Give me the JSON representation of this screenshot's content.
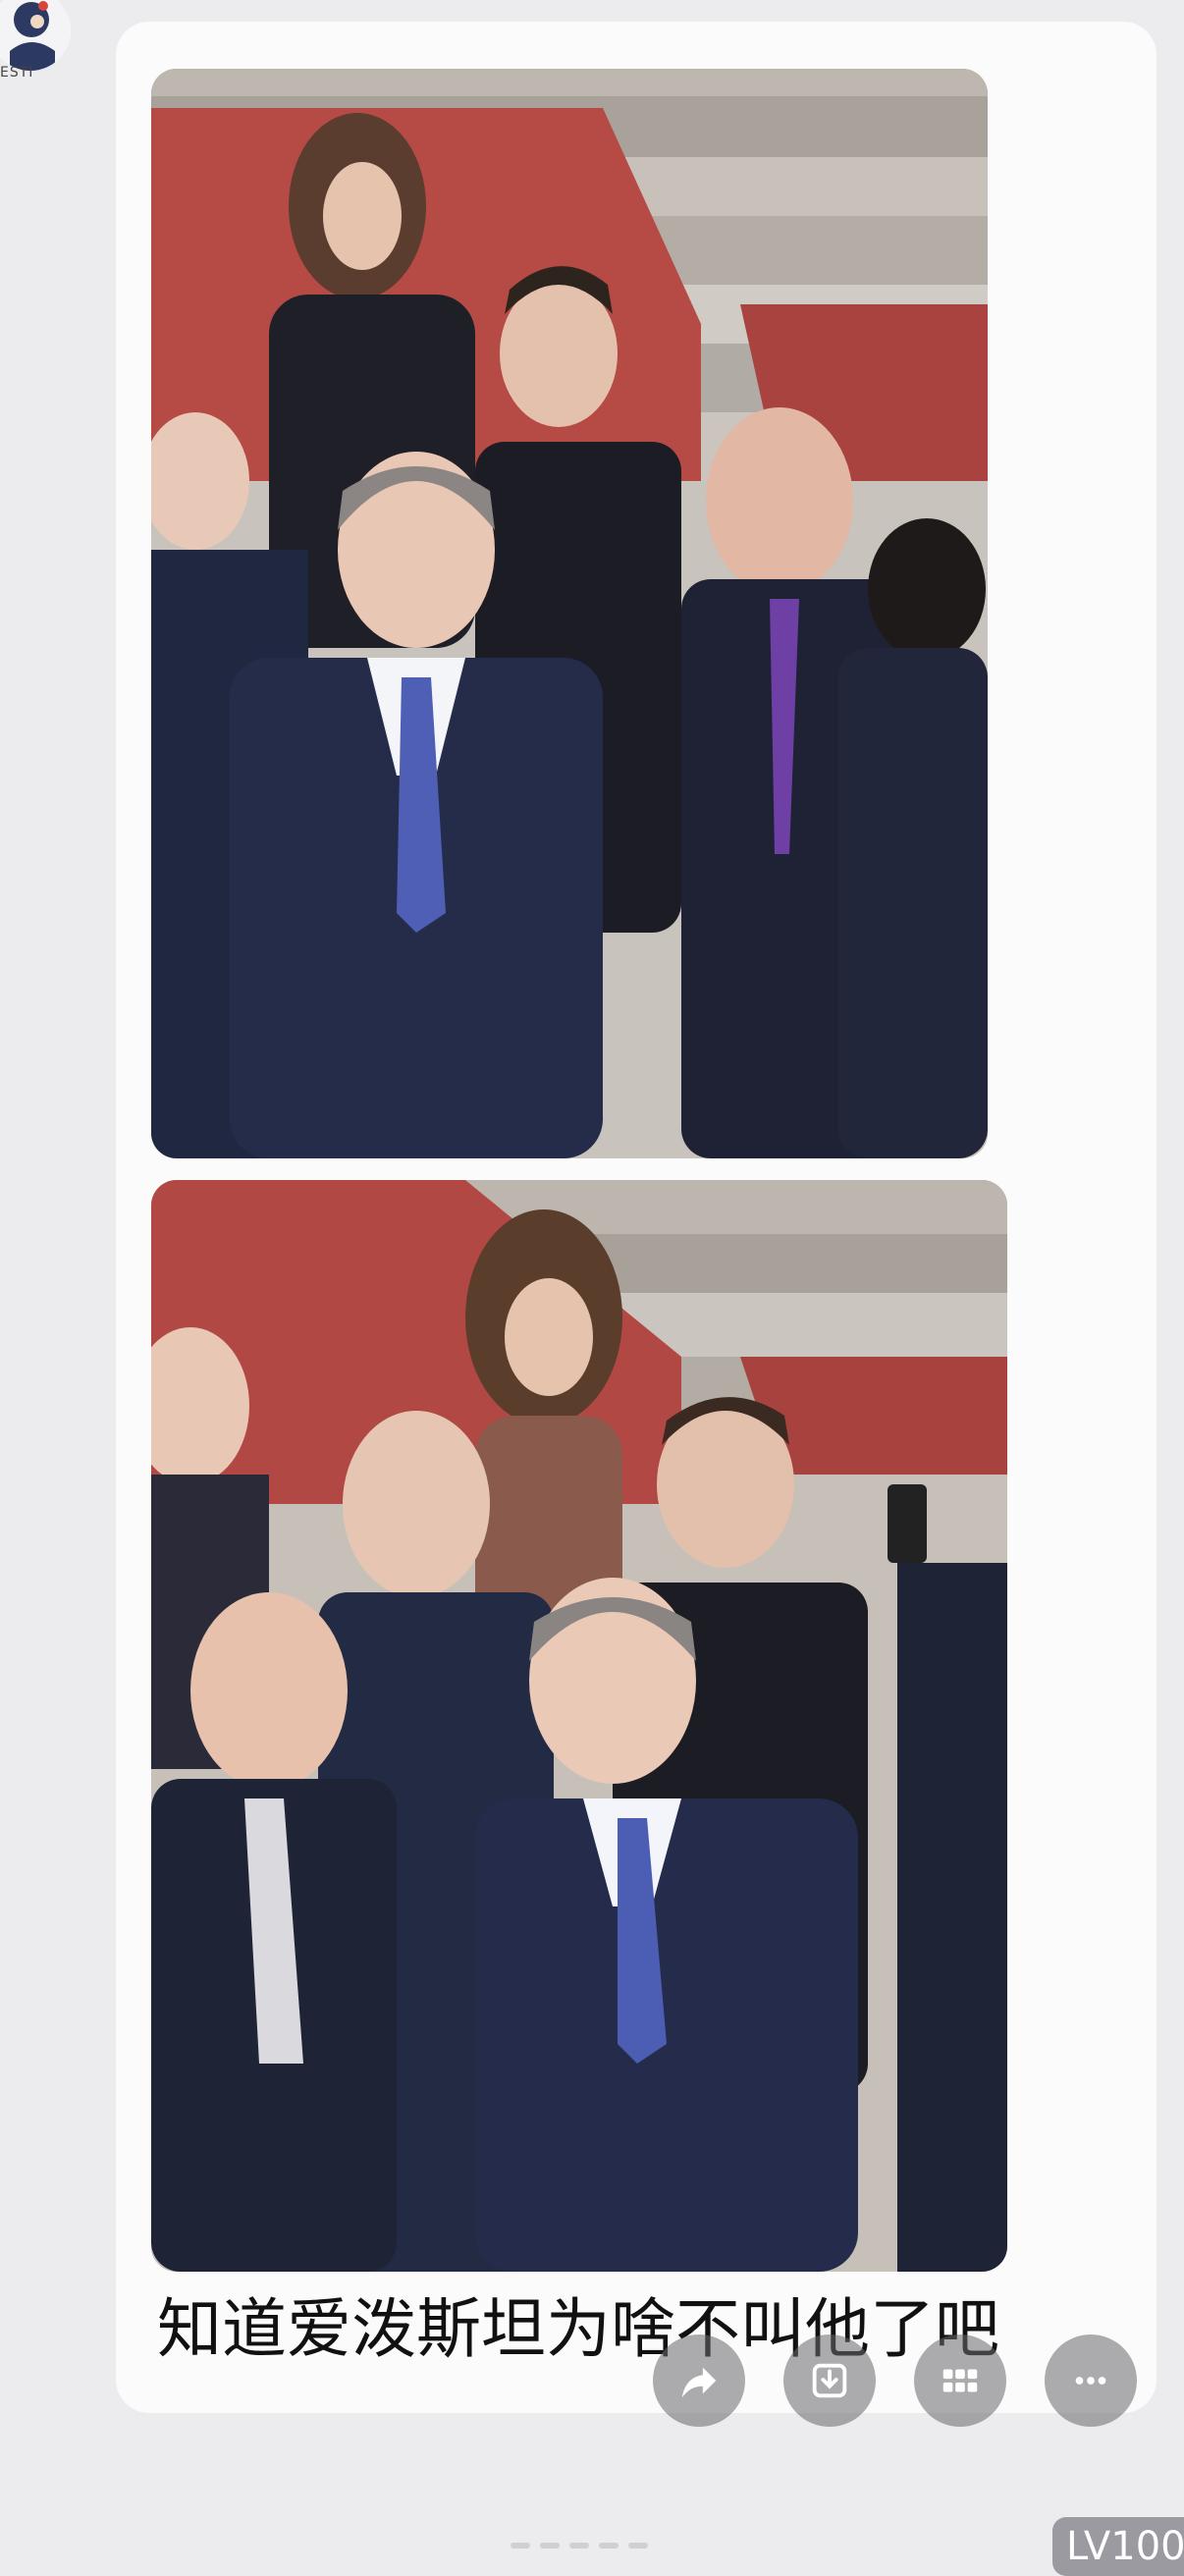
{
  "avatar": {
    "label": "ESTI",
    "icon": "avatar-icon"
  },
  "post": {
    "images": [
      {
        "kind": "photo",
        "name": "photo-1"
      },
      {
        "kind": "photo",
        "name": "photo-2"
      }
    ],
    "caption": "知道爱泼斯坦为啥不叫他了吧"
  },
  "actions": [
    {
      "name": "share-button",
      "icon": "share-icon"
    },
    {
      "name": "save-button",
      "icon": "download-icon"
    },
    {
      "name": "grid-button",
      "icon": "grid-icon"
    },
    {
      "name": "more-button",
      "icon": "more-icon"
    }
  ],
  "level_badge": {
    "text": "LV100"
  },
  "colors": {
    "bubble": "#fbfbfc",
    "background": "#ececef",
    "action": "#69696e"
  }
}
